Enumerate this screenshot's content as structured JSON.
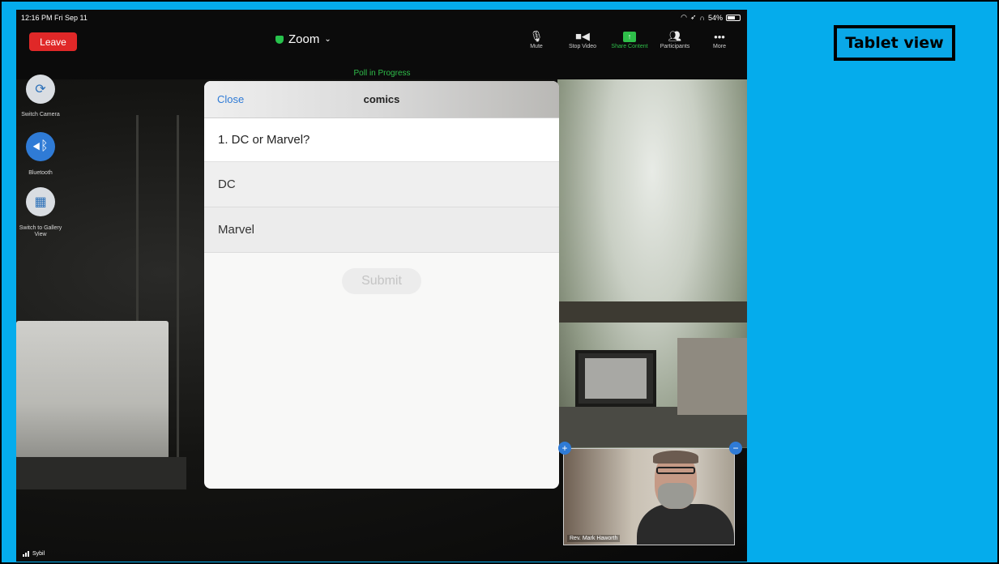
{
  "slide_label": "Tablet view",
  "status_bar": {
    "time": "12:16 PM  Fri Sep 11",
    "battery": "54%"
  },
  "toolbar": {
    "leave": "Leave",
    "title": "Zoom",
    "tools": [
      {
        "label": "Mute",
        "icon": "microphone-icon"
      },
      {
        "label": "Stop Video",
        "icon": "video-camera-icon"
      },
      {
        "label": "Share Content",
        "icon": "share-screen-icon"
      },
      {
        "label": "Participants",
        "icon": "participants-icon"
      },
      {
        "label": "More",
        "icon": "more-dots-icon"
      }
    ]
  },
  "poll_status": "Poll in Progress",
  "side_controls": [
    {
      "label": "Switch Camera",
      "icon": "switch-camera-icon"
    },
    {
      "label": "Bluetooth",
      "icon": "bluetooth-audio-icon"
    },
    {
      "label": "Switch to Gallery View",
      "icon": "gallery-grid-icon"
    }
  ],
  "poll": {
    "close": "Close",
    "title": "comics",
    "question": "1. DC or Marvel?",
    "options": [
      "DC",
      "Marvel"
    ],
    "submit": "Submit"
  },
  "self_view": {
    "name": "Rev. Mark Haworth"
  },
  "network_label": "Sybil",
  "colors": {
    "slide_background": "#05acec",
    "leave_button": "#e02828",
    "accent_green": "#2fbf4a",
    "link_blue": "#2f7bd6"
  }
}
